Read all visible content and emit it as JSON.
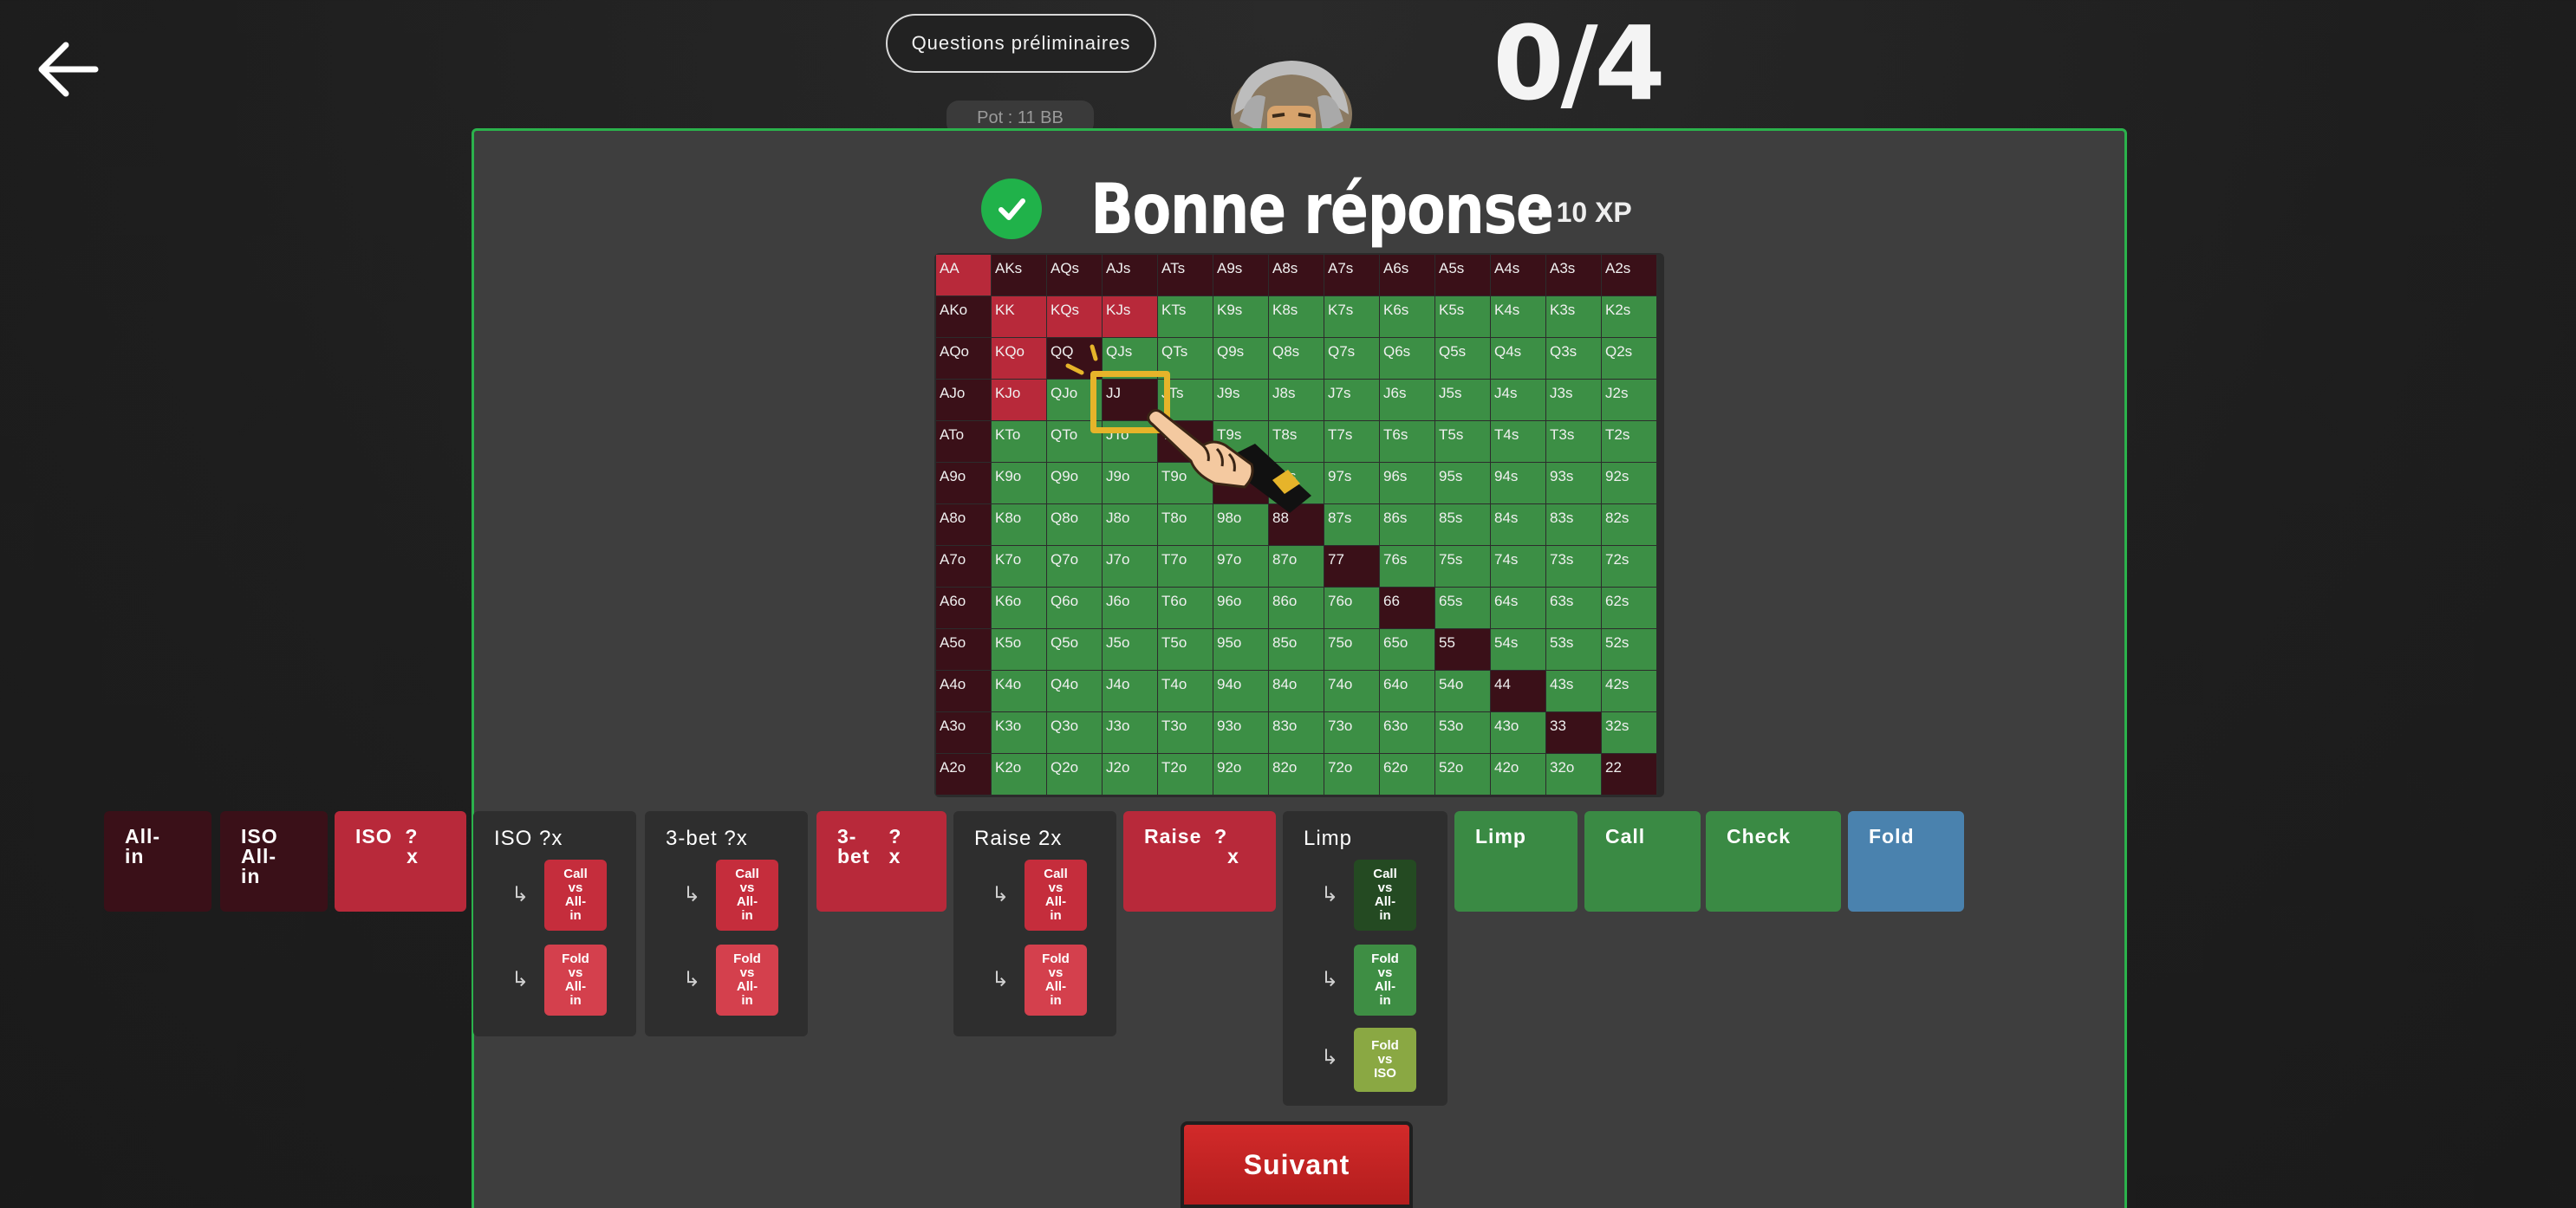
{
  "header": {
    "prelim_label": "Questions préliminaires",
    "score": "0/4",
    "pot": "Pot : 11 BB"
  },
  "result": {
    "title": "Bonne réponse",
    "xp": "+ 10 XP"
  },
  "range_grid": {
    "rows": [
      [
        "AA",
        "AKs",
        "AQs",
        "AJs",
        "ATs",
        "A9s",
        "A8s",
        "A7s",
        "A6s",
        "A5s",
        "A4s",
        "A3s",
        "A2s"
      ],
      [
        "AKo",
        "KK",
        "KQs",
        "KJs",
        "KTs",
        "K9s",
        "K8s",
        "K7s",
        "K6s",
        "K5s",
        "K4s",
        "K3s",
        "K2s"
      ],
      [
        "AQo",
        "KQo",
        "QQ",
        "QJs",
        "QTs",
        "Q9s",
        "Q8s",
        "Q7s",
        "Q6s",
        "Q5s",
        "Q4s",
        "Q3s",
        "Q2s"
      ],
      [
        "AJo",
        "KJo",
        "QJo",
        "JJ",
        "JTs",
        "J9s",
        "J8s",
        "J7s",
        "J6s",
        "J5s",
        "J4s",
        "J3s",
        "J2s"
      ],
      [
        "ATo",
        "KTo",
        "QTo",
        "JTo",
        "TT",
        "T9s",
        "T8s",
        "T7s",
        "T6s",
        "T5s",
        "T4s",
        "T3s",
        "T2s"
      ],
      [
        "A9o",
        "K9o",
        "Q9o",
        "J9o",
        "T9o",
        "99",
        "98s",
        "97s",
        "96s",
        "95s",
        "94s",
        "93s",
        "92s"
      ],
      [
        "A8o",
        "K8o",
        "Q8o",
        "J8o",
        "T8o",
        "98o",
        "88",
        "87s",
        "86s",
        "85s",
        "84s",
        "83s",
        "82s"
      ],
      [
        "A7o",
        "K7o",
        "Q7o",
        "J7o",
        "T7o",
        "97o",
        "87o",
        "77",
        "76s",
        "75s",
        "74s",
        "73s",
        "72s"
      ],
      [
        "A6o",
        "K6o",
        "Q6o",
        "J6o",
        "T6o",
        "96o",
        "86o",
        "76o",
        "66",
        "65s",
        "64s",
        "63s",
        "62s"
      ],
      [
        "A5o",
        "K5o",
        "Q5o",
        "J5o",
        "T5o",
        "95o",
        "85o",
        "75o",
        "65o",
        "55",
        "54s",
        "53s",
        "52s"
      ],
      [
        "A4o",
        "K4o",
        "Q4o",
        "J4o",
        "T4o",
        "94o",
        "84o",
        "74o",
        "64o",
        "54o",
        "44",
        "43s",
        "42s"
      ],
      [
        "A3o",
        "K3o",
        "Q3o",
        "J3o",
        "T3o",
        "93o",
        "83o",
        "73o",
        "63o",
        "53o",
        "43o",
        "33",
        "32s"
      ],
      [
        "A2o",
        "K2o",
        "Q2o",
        "J2o",
        "T2o",
        "92o",
        "82o",
        "72o",
        "62o",
        "52o",
        "42o",
        "32o",
        "22"
      ]
    ],
    "colors": [
      [
        "r",
        "d",
        "d",
        "d",
        "d",
        "d",
        "d",
        "d",
        "d",
        "d",
        "d",
        "d",
        "d"
      ],
      [
        "d",
        "r",
        "r",
        "r",
        "g",
        "g",
        "g",
        "g",
        "g",
        "g",
        "g",
        "g",
        "g"
      ],
      [
        "d",
        "r",
        "d",
        "g",
        "g",
        "g",
        "g",
        "g",
        "g",
        "g",
        "g",
        "g",
        "g"
      ],
      [
        "d",
        "r",
        "g",
        "d",
        "g",
        "g",
        "g",
        "g",
        "g",
        "g",
        "g",
        "g",
        "g"
      ],
      [
        "d",
        "g",
        "g",
        "g",
        "d",
        "g",
        "g",
        "g",
        "g",
        "g",
        "g",
        "g",
        "g"
      ],
      [
        "d",
        "g",
        "g",
        "g",
        "g",
        "d",
        "g",
        "g",
        "g",
        "g",
        "g",
        "g",
        "g"
      ],
      [
        "d",
        "g",
        "g",
        "g",
        "g",
        "g",
        "d",
        "g",
        "g",
        "g",
        "g",
        "g",
        "g"
      ],
      [
        "d",
        "g",
        "g",
        "g",
        "g",
        "g",
        "g",
        "d",
        "g",
        "g",
        "g",
        "g",
        "g"
      ],
      [
        "d",
        "g",
        "g",
        "g",
        "g",
        "g",
        "g",
        "g",
        "d",
        "g",
        "g",
        "g",
        "g"
      ],
      [
        "d",
        "g",
        "g",
        "g",
        "g",
        "g",
        "g",
        "g",
        "g",
        "d",
        "g",
        "g",
        "g"
      ],
      [
        "d",
        "g",
        "g",
        "g",
        "g",
        "g",
        "g",
        "g",
        "g",
        "g",
        "d",
        "g",
        "g"
      ],
      [
        "d",
        "g",
        "g",
        "g",
        "g",
        "g",
        "g",
        "g",
        "g",
        "g",
        "g",
        "d",
        "g"
      ],
      [
        "d",
        "g",
        "g",
        "g",
        "g",
        "g",
        "g",
        "g",
        "g",
        "g",
        "g",
        "g",
        "d"
      ]
    ],
    "palette": {
      "g": "#3c8f45",
      "d": "#3a1018",
      "r": "#b8293a"
    },
    "selected": "JJ"
  },
  "actions": {
    "allin": "All-\nin",
    "iso_allin": "ISO\nAll-\nin",
    "iso_x": "ISO  ?\n        x",
    "iso_group": {
      "title": "ISO ?x",
      "call": "Call\nvs\nAll-\nin",
      "fold": "Fold\nvs\nAll-\nin"
    },
    "threebet_group": {
      "title": "3-bet ?x",
      "call": "Call\nvs\nAll-\nin",
      "fold": "Fold\nvs\nAll-\nin"
    },
    "threebet_x": "3-     ?\nbet   x",
    "raise2x_group": {
      "title": "Raise 2x",
      "call": "Call\nvs\nAll-\nin",
      "fold": "Fold\nvs\nAll-\nin"
    },
    "raise_x": "Raise  ?\n             x",
    "limp_group": {
      "title": "Limp",
      "call": "Call\nvs\nAll-\nin",
      "fold_allin": "Fold\nvs\nAll-\nin",
      "fold_iso": "Fold\nvs\nISO"
    },
    "limp": "Limp",
    "call": "Call",
    "check": "Check",
    "fold": "Fold"
  },
  "footer": {
    "next_label": "Suivant"
  },
  "icons": {
    "back": "arrow-left-icon",
    "check": "check-icon",
    "hand": "pointing-hand-icon",
    "sub_arrow": "return-arrow-icon"
  }
}
